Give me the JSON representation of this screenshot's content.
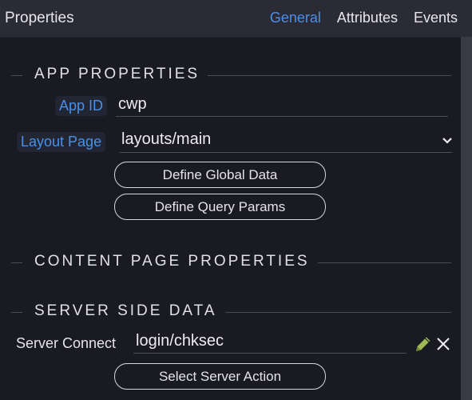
{
  "header": {
    "title": "Properties",
    "tabs": [
      {
        "label": "General",
        "active": true
      },
      {
        "label": "Attributes",
        "active": false
      },
      {
        "label": "Events",
        "active": false
      }
    ]
  },
  "sections": {
    "app": {
      "heading": "APP PROPERTIES",
      "app_id": {
        "label": "App ID",
        "value": "cwp"
      },
      "layout_page": {
        "label": "Layout Page",
        "value": "layouts/main"
      },
      "buttons": {
        "define_global_data": "Define Global Data",
        "define_query_params": "Define Query Params"
      }
    },
    "content": {
      "heading": "CONTENT PAGE PROPERTIES"
    },
    "server": {
      "heading": "SERVER SIDE DATA",
      "server_connect": {
        "label": "Server Connect",
        "value": "login/chksec"
      },
      "buttons": {
        "select_server_action": "Select Server Action"
      },
      "icons": {
        "edit": "pencil-icon",
        "remove": "close-icon"
      }
    }
  },
  "colors": {
    "accent": "#4a90e8",
    "pencil": "#9dba55",
    "background": "#1a1a22",
    "header_bg": "#2b2b35"
  }
}
